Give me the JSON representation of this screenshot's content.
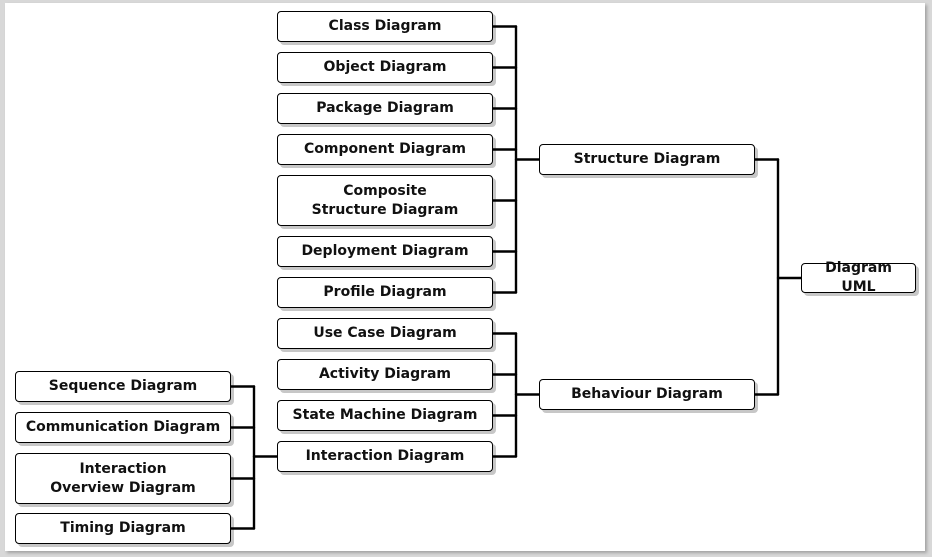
{
  "diagram": {
    "root": {
      "id": "uml",
      "label": "Diagram UML"
    },
    "nodes": [
      {
        "id": "structure",
        "label": "Structure Diagram",
        "parent": "uml"
      },
      {
        "id": "behaviour",
        "label": "Behaviour Diagram",
        "parent": "uml"
      },
      {
        "id": "class",
        "label": "Class Diagram",
        "parent": "structure"
      },
      {
        "id": "object",
        "label": "Object Diagram",
        "parent": "structure"
      },
      {
        "id": "package",
        "label": "Package Diagram",
        "parent": "structure"
      },
      {
        "id": "component",
        "label": "Component Diagram",
        "parent": "structure"
      },
      {
        "id": "composite",
        "label": "Composite Structure Diagram",
        "parent": "structure"
      },
      {
        "id": "deployment",
        "label": "Deployment Diagram",
        "parent": "structure"
      },
      {
        "id": "profile",
        "label": "Profile Diagram",
        "parent": "structure"
      },
      {
        "id": "usecase",
        "label": "Use Case Diagram",
        "parent": "behaviour"
      },
      {
        "id": "activity",
        "label": "Activity Diagram",
        "parent": "behaviour"
      },
      {
        "id": "statemachine",
        "label": "State Machine Diagram",
        "parent": "behaviour"
      },
      {
        "id": "interaction",
        "label": "Interaction Diagram",
        "parent": "behaviour"
      },
      {
        "id": "sequence",
        "label": "Sequence Diagram",
        "parent": "interaction"
      },
      {
        "id": "communication",
        "label": "Communication Diagram",
        "parent": "interaction"
      },
      {
        "id": "interactionoverview",
        "label": "Interaction Overview Diagram",
        "parent": "interaction"
      },
      {
        "id": "timing",
        "label": "Timing Diagram",
        "parent": "interaction"
      }
    ]
  }
}
